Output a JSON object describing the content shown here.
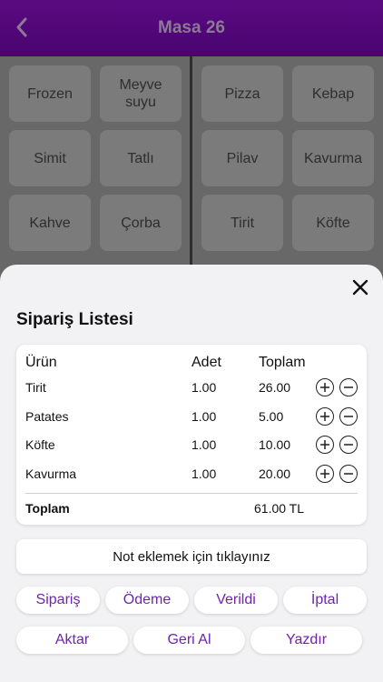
{
  "header": {
    "title": "Masa 26"
  },
  "tiles": {
    "frozen": "Frozen",
    "meyve_suyu_1": "Meyve",
    "meyve_suyu_2": "suyu",
    "pizza": "Pizza",
    "kebap": "Kebap",
    "simit": "Simit",
    "tatli": "Tatlı",
    "pilav": "Pilav",
    "kavurma": "Kavurma",
    "kahve": "Kahve",
    "corba": "Çorba",
    "tirit": "Tirit",
    "kofte": "Köfte"
  },
  "order": {
    "title": "Sipariş Listesi",
    "columns": [
      "Ürün",
      "Adet",
      "Toplam"
    ],
    "items": [
      {
        "name": "Tirit",
        "qty": "1.00",
        "total": "26.00"
      },
      {
        "name": "Patates",
        "qty": "1.00",
        "total": "5.00"
      },
      {
        "name": "Köfte",
        "qty": "1.00",
        "total": "10.00"
      },
      {
        "name": "Kavurma",
        "qty": "1.00",
        "total": "20.00"
      }
    ],
    "total_label": "Toplam",
    "total_value": "61.00 TL",
    "note_placeholder": "Not eklemek için tıklayınız"
  },
  "actions": {
    "siparis": "Sipariş",
    "odeme": "Ödeme",
    "verildi": "Verildi",
    "iptal": "İptal",
    "aktar": "Aktar",
    "geri_al": "Geri Al",
    "yazdir": "Yazdır"
  },
  "colors": {
    "accent": "#6f23b0",
    "header": "#4a0470"
  },
  "icons": {
    "back": "chevron-left-icon",
    "close": "close-icon",
    "plus": "plus-icon",
    "minus": "minus-icon"
  }
}
